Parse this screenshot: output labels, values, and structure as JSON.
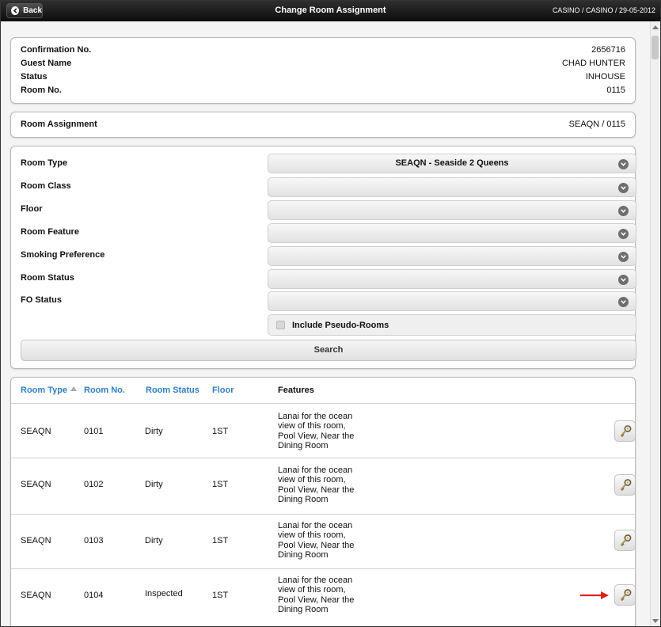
{
  "header": {
    "back_label": "Back",
    "title": "Change Room Assignment",
    "crumb": "CASINO / CASINO / 29-05-2012"
  },
  "reservation": {
    "rows": [
      {
        "label": "Confirmation No.",
        "value": "2656716"
      },
      {
        "label": "Guest Name",
        "value": "CHAD HUNTER"
      },
      {
        "label": "Status",
        "value": "INHOUSE"
      },
      {
        "label": "Room No.",
        "value": "0115"
      }
    ]
  },
  "room_assignment": {
    "label": "Room Assignment",
    "value": "SEAQN / 0115"
  },
  "search_form": {
    "fields": [
      {
        "label": "Room Type",
        "value": "SEAQN - Seaside 2 Queens"
      },
      {
        "label": "Room Class",
        "value": ""
      },
      {
        "label": "Floor",
        "value": ""
      },
      {
        "label": "Room Feature",
        "value": ""
      },
      {
        "label": "Smoking Preference",
        "value": ""
      },
      {
        "label": "Room Status",
        "value": ""
      },
      {
        "label": "FO Status",
        "value": ""
      }
    ],
    "pseudo_label": "Include Pseudo-Rooms",
    "pseudo_checked": false,
    "search_label": "Search"
  },
  "results": {
    "columns": [
      "Room Type",
      "Room No.",
      "Room Status",
      "Floor",
      "Features"
    ],
    "sort_column": "Room Type",
    "rows": [
      {
        "type": "SEAQN",
        "room": "0101",
        "status": "Dirty",
        "floor": "1ST",
        "features": [
          "Lanai for the ocean",
          "view of this room,",
          "Pool View, Near the",
          "Dining Room"
        ]
      },
      {
        "type": "SEAQN",
        "room": "0102",
        "status": "Dirty",
        "floor": "1ST",
        "features": [
          "Lanai for the ocean",
          "view of this room,",
          "Pool View, Near the",
          "Dining Room"
        ]
      },
      {
        "type": "SEAQN",
        "room": "0103",
        "status": "Dirty",
        "floor": "1ST",
        "features": [
          "Lanai for the ocean",
          "view of this room,",
          "Pool View, Near the",
          "Dining Room"
        ]
      },
      {
        "type": "SEAQN",
        "room": "0104",
        "status": "Inspected",
        "floor": "1ST",
        "features": [
          "Lanai for the ocean",
          "view of this room,",
          "Pool View, Near the",
          "Dining Room"
        ]
      }
    ],
    "action_icon": "key-icon"
  },
  "colors": {
    "accent": "#2f7fc1",
    "arrow": "#e0201a"
  }
}
